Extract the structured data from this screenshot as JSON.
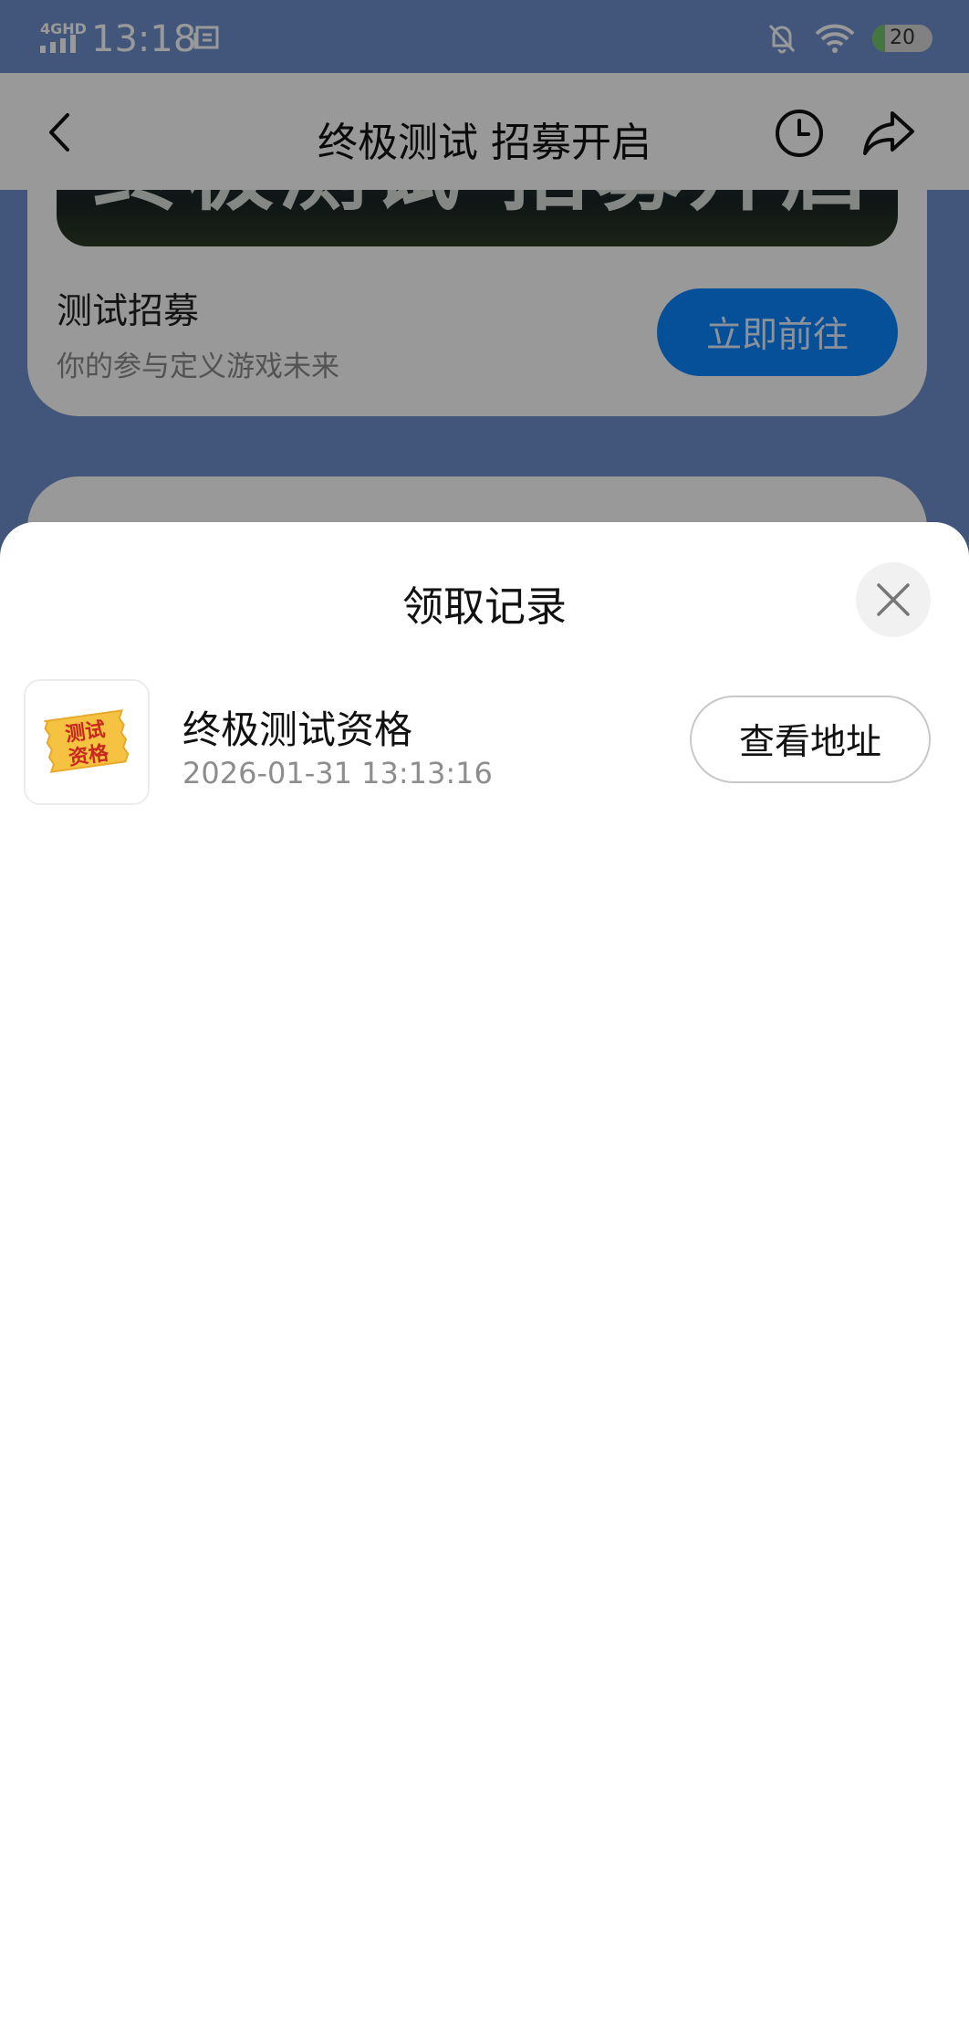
{
  "status_bar": {
    "network": "4GHD",
    "time": "13:18",
    "battery_level": "20"
  },
  "header": {
    "title": "终极测试 招募开启"
  },
  "background": {
    "banner_text": "终极测试 招募开启",
    "recruit_card": {
      "title": "测试招募",
      "subtitle": "你的参与定义游戏未来",
      "button_label": "立即前往"
    }
  },
  "sheet": {
    "title": "领取记录",
    "records": [
      {
        "thumb_text": [
          "测试",
          "资格"
        ],
        "name": "终极测试资格",
        "time": "2026-01-31 13:13:16",
        "button_label": "查看地址"
      }
    ]
  },
  "colors": {
    "accent_blue": "#0a84ff",
    "ticket_yellow": "#f5c242",
    "ticket_red": "#c8281e"
  }
}
